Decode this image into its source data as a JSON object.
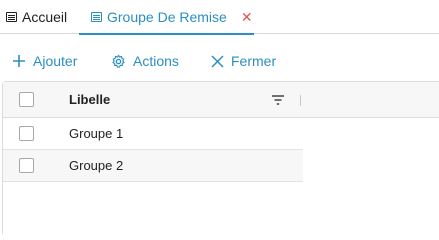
{
  "tabs": {
    "home": {
      "label": "Accueil",
      "icon": "document-icon"
    },
    "active": {
      "label": "Groupe De Remise",
      "icon": "document-icon",
      "close_icon": "close-icon"
    }
  },
  "toolbar": {
    "add_label": "Ajouter",
    "actions_label": "Actions",
    "close_label": "Fermer"
  },
  "grid": {
    "columns": [
      {
        "label": "Libelle"
      }
    ],
    "rows": [
      {
        "libelle": "Groupe 1",
        "selected": false
      },
      {
        "libelle": "Groupe 2",
        "selected": false
      }
    ]
  },
  "colors": {
    "accent": "#2b8fbf",
    "close": "#e05555"
  }
}
